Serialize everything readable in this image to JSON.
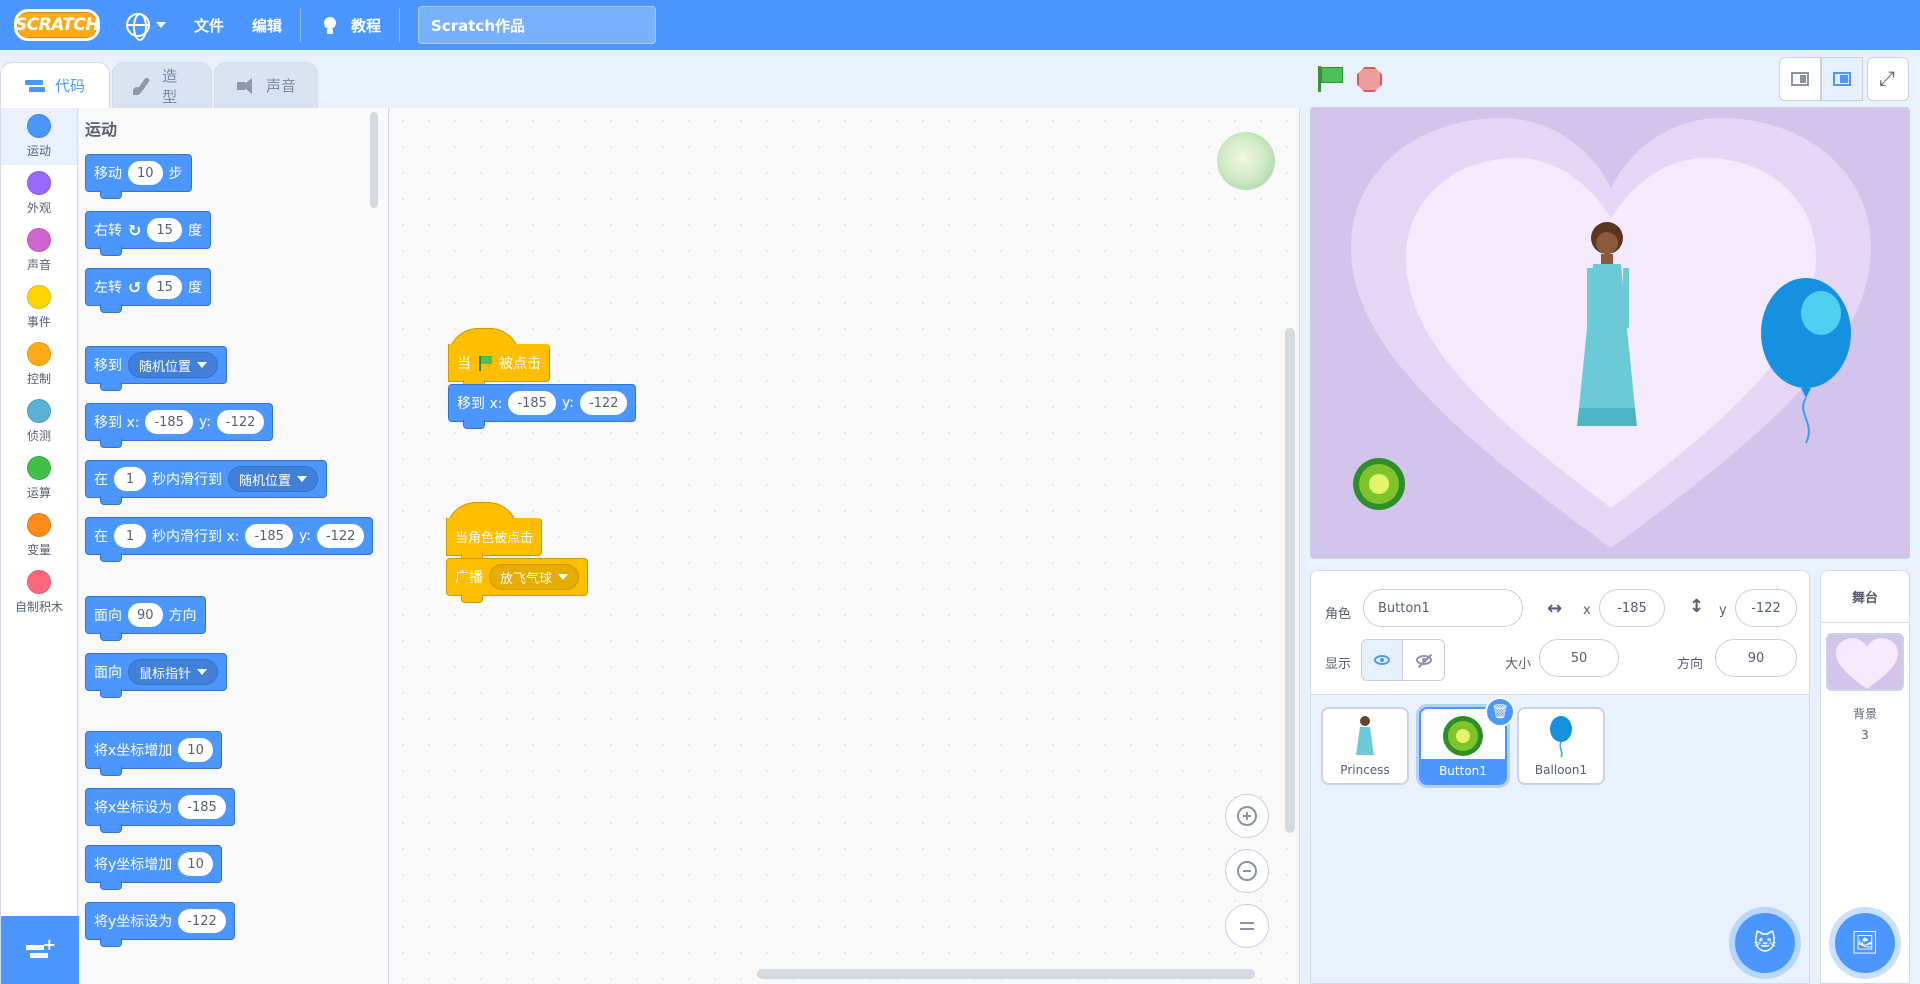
{
  "menubar": {
    "logo": "SCRATCH",
    "file": "文件",
    "edit": "编辑",
    "tutorials": "教程",
    "project_title": "Scratch作品"
  },
  "tabs": [
    {
      "label": "代码",
      "icon": "code-icon",
      "active": true
    },
    {
      "label": "造型",
      "icon": "brush-icon",
      "active": false
    },
    {
      "label": "声音",
      "icon": "speaker-icon",
      "active": false
    }
  ],
  "categories": [
    {
      "label": "运动",
      "color": "#4c97ff"
    },
    {
      "label": "外观",
      "color": "#9966ff"
    },
    {
      "label": "声音",
      "color": "#cf63cf"
    },
    {
      "label": "事件",
      "color": "#ffd500"
    },
    {
      "label": "控制",
      "color": "#ffab19"
    },
    {
      "label": "侦测",
      "color": "#5cb1d6"
    },
    {
      "label": "运算",
      "color": "#40bf4a"
    },
    {
      "label": "变量",
      "color": "#ff8c1a"
    },
    {
      "label": "自制积木",
      "color": "#ff6680"
    }
  ],
  "palette": {
    "heading": "运动",
    "move": {
      "pre": "移动",
      "value": "10",
      "post": "步"
    },
    "turn_right": {
      "pre": "右转",
      "value": "15",
      "post": "度"
    },
    "turn_left": {
      "pre": "左转",
      "value": "15",
      "post": "度"
    },
    "goto": {
      "pre": "移到",
      "menu": "随机位置"
    },
    "goto_xy": {
      "pre": "移到 x:",
      "x": "-185",
      "ylabel": "y:",
      "y": "-122"
    },
    "glide": {
      "pre": "在",
      "secs": "1",
      "mid": "秒内滑行到",
      "menu": "随机位置"
    },
    "glide_xy": {
      "pre": "在",
      "secs": "1",
      "mid": "秒内滑行到 x:",
      "x": "-185",
      "ylabel": "y:",
      "y": "-122"
    },
    "point_dir": {
      "pre": "面向",
      "value": "90",
      "post": "方向"
    },
    "point_towards": {
      "pre": "面向",
      "menu": "鼠标指针"
    },
    "change_x": {
      "pre": "将x坐标增加",
      "value": "10"
    },
    "set_x": {
      "pre": "将x坐标设为",
      "value": "-185"
    },
    "change_y": {
      "pre": "将y坐标增加",
      "value": "10"
    },
    "set_y": {
      "pre": "将y坐标设为",
      "value": "-122"
    }
  },
  "scripts": {
    "script1": {
      "hat_pre": "当",
      "hat_post": "被点击",
      "cmd_pre": "移到 x:",
      "x": "-185",
      "ylabel": "y:",
      "y": "-122"
    },
    "script2": {
      "hat": "当角色被点击",
      "cmd_pre": "广播",
      "menu": "放飞气球"
    }
  },
  "sprite_info": {
    "sprite_label": "角色",
    "sprite_name": "Button1",
    "x_label": "x",
    "x": "-185",
    "y_label": "y",
    "y": "-122",
    "show_label": "显示",
    "size_label": "大小",
    "size": "50",
    "direction_label": "方向",
    "direction": "90"
  },
  "sprites": [
    {
      "name": "Princess",
      "selected": false
    },
    {
      "name": "Button1",
      "selected": true
    },
    {
      "name": "Balloon1",
      "selected": false
    }
  ],
  "stage_pane": {
    "title": "舞台",
    "backdrops_label": "背景",
    "backdrop_count": "3"
  }
}
